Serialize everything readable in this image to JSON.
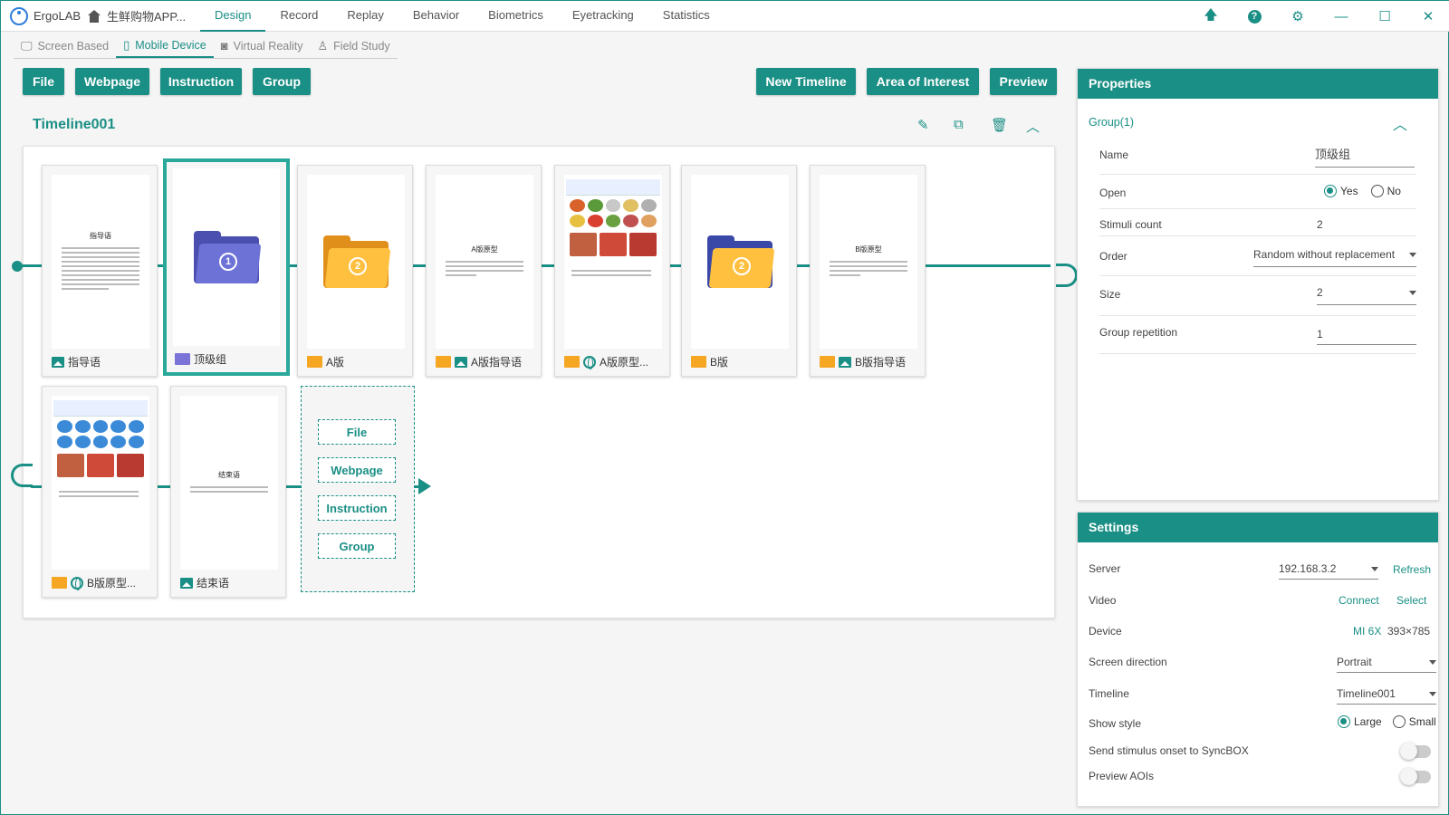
{
  "app": {
    "name": "ErgoLAB",
    "project": "生鲜购物APP..."
  },
  "menu": [
    "Design",
    "Record",
    "Replay",
    "Behavior",
    "Biometrics",
    "Eyetracking",
    "Statistics"
  ],
  "subtabs": [
    "Screen Based",
    "Mobile Device",
    "Virtual Reality",
    "Field Study"
  ],
  "toolbar": {
    "file": "File",
    "webpage": "Webpage",
    "instruction": "Instruction",
    "group": "Group",
    "new_timeline": "New Timeline",
    "aoi": "Area of Interest",
    "preview": "Preview"
  },
  "timeline": {
    "title": "Timeline001"
  },
  "cards": [
    {
      "label": "指导语",
      "kind": "doc",
      "doc_title": "指导语"
    },
    {
      "label": "顶级组",
      "kind": "folder",
      "number": "1",
      "color": "#5b62c9"
    },
    {
      "label": "A版",
      "kind": "folder",
      "number": "2",
      "color": "#f5a623"
    },
    {
      "label": "A版指导语",
      "kind": "doc",
      "doc_title": "A版原型"
    },
    {
      "label": "A版原型...",
      "kind": "app"
    },
    {
      "label": "B版",
      "kind": "folder",
      "number": "2",
      "color": "#f5a623"
    },
    {
      "label": "B版指导语",
      "kind": "doc",
      "doc_title": "B版原型"
    },
    {
      "label": "B版原型...",
      "kind": "app"
    },
    {
      "label": "结束语",
      "kind": "doc",
      "doc_title": "结束语"
    }
  ],
  "drop_buttons": [
    "File",
    "Webpage",
    "Instruction",
    "Group"
  ],
  "properties": {
    "title": "Properties",
    "group_title": "Group(1)",
    "name_label": "Name",
    "name_value": "顶级组",
    "open_label": "Open",
    "open_yes": "Yes",
    "open_no": "No",
    "stimuli_label": "Stimuli count",
    "stimuli_value": "2",
    "order_label": "Order",
    "order_value": "Random without replacement",
    "size_label": "Size",
    "size_value": "2",
    "repetition_label": "Group repetition",
    "repetition_value": "1"
  },
  "settings": {
    "title": "Settings",
    "server_label": "Server",
    "server_value": "192.168.3.2",
    "refresh": "Refresh",
    "video_label": "Video",
    "connect": "Connect",
    "select": "Select",
    "device_label": "Device",
    "device_model": "MI 6X",
    "device_res": "393×785",
    "direction_label": "Screen direction",
    "direction_value": "Portrait",
    "timeline_label": "Timeline",
    "timeline_value": "Timeline001",
    "style_label": "Show style",
    "style_large": "Large",
    "style_small": "Small",
    "syncbox_label": "Send stimulus onset to SyncBOX",
    "preview_aoi_label": "Preview AOIs"
  }
}
